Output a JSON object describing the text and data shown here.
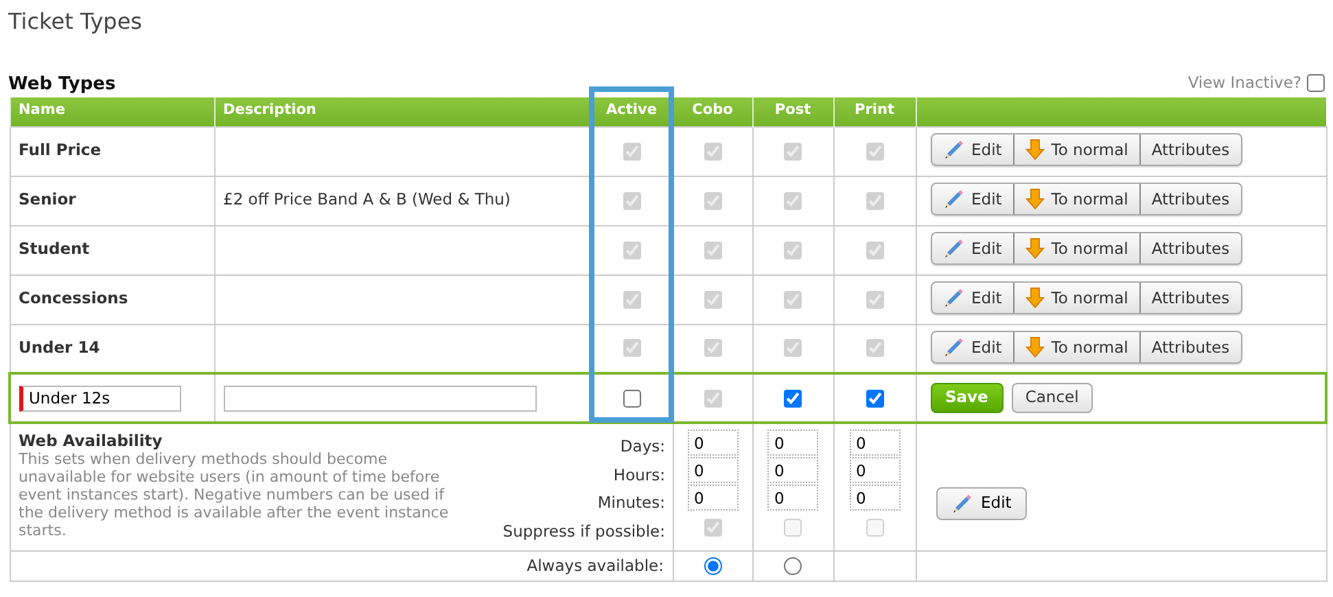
{
  "page_title": "Ticket Types",
  "section_title": "Web Types",
  "view_inactive": {
    "label": "View Inactive?",
    "checked": false
  },
  "columns": [
    {
      "label": "Name",
      "highlighted": false
    },
    {
      "label": "Description",
      "highlighted": false
    },
    {
      "label": "Active",
      "highlighted": true
    },
    {
      "label": "Cobo",
      "highlighted": false
    },
    {
      "label": "Post",
      "highlighted": false
    },
    {
      "label": "Print",
      "highlighted": false
    }
  ],
  "rows": [
    {
      "name": "Full Price",
      "flags": [
        {
          "checked": true,
          "disabled": true
        },
        {
          "checked": true,
          "disabled": true
        },
        {
          "checked": true,
          "disabled": true
        },
        {
          "checked": true,
          "disabled": true
        }
      ],
      "actions": [
        "Edit",
        "To normal",
        "Attributes"
      ]
    },
    {
      "name": "Senior",
      "description": "£2 off Price Band A & B (Wed & Thu)",
      "flags": [
        {
          "checked": true,
          "disabled": true
        },
        {
          "checked": true,
          "disabled": true
        },
        {
          "checked": true,
          "disabled": true
        },
        {
          "checked": true,
          "disabled": true
        }
      ],
      "actions": [
        "Edit",
        "To normal",
        "Attributes"
      ]
    },
    {
      "name": "Student",
      "flags": [
        {
          "checked": true,
          "disabled": true
        },
        {
          "checked": true,
          "disabled": true
        },
        {
          "checked": true,
          "disabled": true
        },
        {
          "checked": true,
          "disabled": true
        }
      ],
      "actions": [
        "Edit",
        "To normal",
        "Attributes"
      ]
    },
    {
      "name": "Concessions",
      "flags": [
        {
          "checked": true,
          "disabled": true
        },
        {
          "checked": true,
          "disabled": true
        },
        {
          "checked": true,
          "disabled": true
        },
        {
          "checked": true,
          "disabled": true
        }
      ],
      "actions": [
        "Edit",
        "To normal",
        "Attributes"
      ]
    },
    {
      "name": "Under 14",
      "flags": [
        {
          "checked": true,
          "disabled": true
        },
        {
          "checked": true,
          "disabled": true
        },
        {
          "checked": true,
          "disabled": true
        },
        {
          "checked": true,
          "disabled": true
        }
      ],
      "actions": [
        "Edit",
        "To normal",
        "Attributes"
      ]
    }
  ],
  "edit_row": {
    "name": "Under 12s",
    "required": true,
    "flags": [
      {
        "checked": false,
        "disabled": false
      },
      {
        "checked": true,
        "disabled": true
      },
      {
        "checked": true,
        "disabled": false
      },
      {
        "checked": true,
        "disabled": false
      }
    ],
    "buttons": [
      {
        "label": "Save",
        "kind": "primary"
      },
      {
        "label": "Cancel",
        "kind": "secondary"
      }
    ]
  },
  "availability": {
    "title": "Web Availability",
    "text": "This sets when delivery methods should become unavailable for website users (in amount of time before event instances start). Negative numbers can be used if the delivery method is available after the event instance starts.",
    "labels": [
      "Days:",
      "Hours:",
      "Minutes:",
      "Suppress if possible:"
    ],
    "columns": [
      {
        "days": "0",
        "hours": "0",
        "minutes": "0",
        "suppress": {
          "checked": true,
          "disabled": true
        }
      },
      {
        "days": "0",
        "hours": "0",
        "minutes": "0",
        "suppress": {
          "checked": false,
          "disabled": true
        }
      },
      {
        "days": "0",
        "hours": "0",
        "minutes": "0",
        "suppress": {
          "checked": false,
          "disabled": true
        }
      }
    ],
    "button": "Edit",
    "always_label": "Always available:",
    "always": [
      {
        "selected": true
      },
      {
        "selected": false
      }
    ]
  }
}
